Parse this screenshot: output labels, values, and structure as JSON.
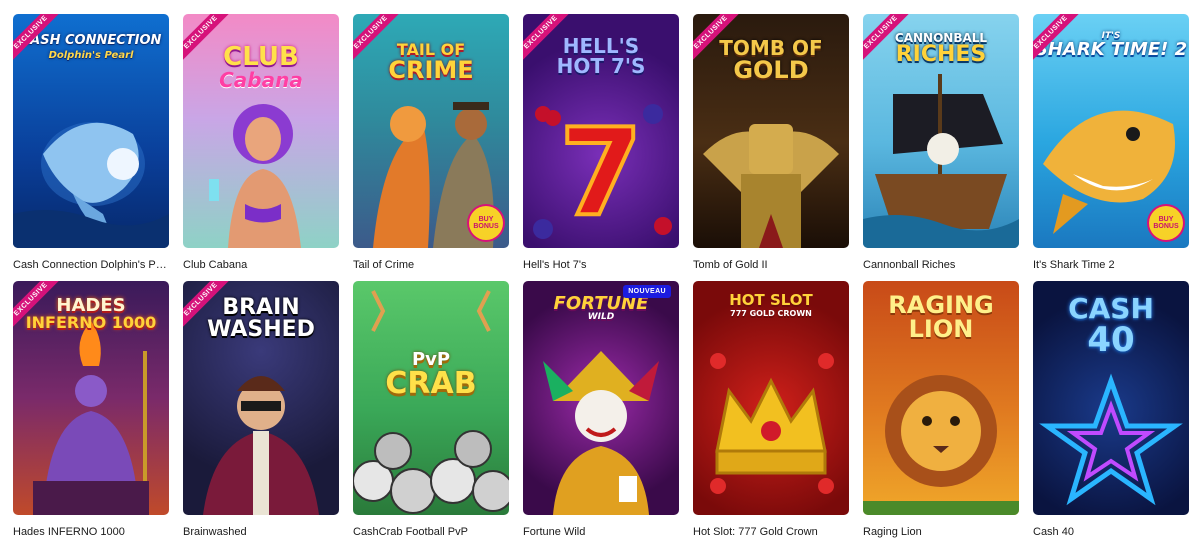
{
  "labels": {
    "exclusive": "EXCLUSIVE",
    "new": "NOUVEAU",
    "buy_bonus": "BUY BONUS"
  },
  "games": [
    {
      "title": "Cash Connection Dolphin's Pearl",
      "logo_line1": "CASH CONNECTION",
      "logo_line2": "Dolphin's Pearl"
    },
    {
      "title": "Club Cabana",
      "logo_line1": "CLUB",
      "logo_line2": "Cabana"
    },
    {
      "title": "Tail of Crime",
      "logo_line1": "TAIL OF",
      "logo_line2": "CRIME"
    },
    {
      "title": "Hell's Hot 7's",
      "logo_line1": "HELL'S",
      "logo_line2": "HOT 7'S"
    },
    {
      "title": "Tomb of Gold II",
      "logo_line1": "TOMB OF",
      "logo_line2": "GOLD"
    },
    {
      "title": "Cannonball Riches",
      "logo_line1": "CANNONBALL",
      "logo_line2": "RICHES"
    },
    {
      "title": "It's Shark Time 2",
      "logo_line1": "IT'S",
      "logo_line2": "SHARK TIME! 2"
    },
    {
      "title": "Hades INFERNO 1000",
      "logo_line1": "HADES",
      "logo_line2": "INFERNO 1000"
    },
    {
      "title": "Brainwashed",
      "logo_line1": "BRAIN",
      "logo_line2": "WASHED"
    },
    {
      "title": "CashCrab Football PvP",
      "logo_line1": "PvP",
      "logo_line2": "CRAB"
    },
    {
      "title": "Fortune Wild",
      "logo_line1": "FORTUNE",
      "logo_line2": "WILD"
    },
    {
      "title": "Hot Slot: 777 Gold Crown",
      "logo_line1": "HOT SLOT",
      "logo_line2": "777 GOLD CROWN"
    },
    {
      "title": "Raging Lion",
      "logo_line1": "RAGING",
      "logo_line2": "LION"
    },
    {
      "title": "Cash 40",
      "logo_line1": "CASH",
      "logo_line2": "40"
    }
  ],
  "colors": {
    "exclusive_ribbon": "#d6127a",
    "new_badge": "#1c1ce0",
    "title_text": "#1a1a1a"
  }
}
